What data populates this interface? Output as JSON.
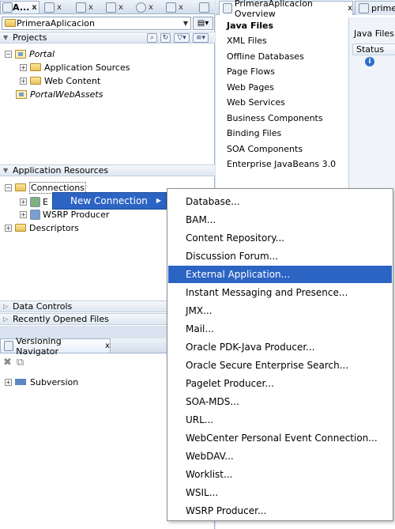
{
  "left": {
    "top_tabs": [
      {
        "label": "A..."
      },
      {
        "label": "x"
      }
    ],
    "app_selector": "PrimeraAplicacion",
    "projects_header": "Projects",
    "tree": {
      "portal": "Portal",
      "app_sources": "Application Sources",
      "web_content": "Web Content",
      "portal_web_assets": "PortalWebAssets"
    },
    "app_resources_header": "Application Resources",
    "resources_tree": {
      "connections": "Connections",
      "e_item": "E",
      "wsrp_producer": "WSRP Producer",
      "descriptors": "Descriptors"
    },
    "data_controls": "Data Controls",
    "recently_opened": "Recently Opened Files",
    "versioning_tab": "Versioning Navigator",
    "versioning_close": "x",
    "subversion": "Subversion"
  },
  "right": {
    "tab_active": "PrimeraAplicacion Overview",
    "tab_close": "x",
    "tab_other": "prime",
    "categories": [
      "Java Files",
      "XML Files",
      "Offline Databases",
      "Page Flows",
      "Web Pages",
      "Web Services",
      "Business Components",
      "Binding Files",
      "SOA Components",
      "Enterprise JavaBeans 3.0"
    ],
    "overview_label": "Java Files:",
    "status_col": "Status",
    "info_glyph": "i"
  },
  "context_menu": {
    "new_connection": "New Connection"
  },
  "submenu": {
    "items": [
      "Database...",
      "BAM...",
      "Content Repository...",
      "Discussion Forum...",
      "External Application...",
      "Instant Messaging and Presence...",
      "JMX...",
      "Mail...",
      "Oracle PDK-Java Producer...",
      "Oracle Secure Enterprise Search...",
      "Pagelet Producer...",
      "SOA-MDS...",
      "URL...",
      "WebCenter Personal Event Connection...",
      "WebDAV...",
      "Worklist...",
      "WSIL...",
      "WSRP Producer..."
    ],
    "highlighted_index": 4
  },
  "colors": {
    "highlight": "#2c64c4",
    "panel_bg": "#d9e3ef"
  }
}
